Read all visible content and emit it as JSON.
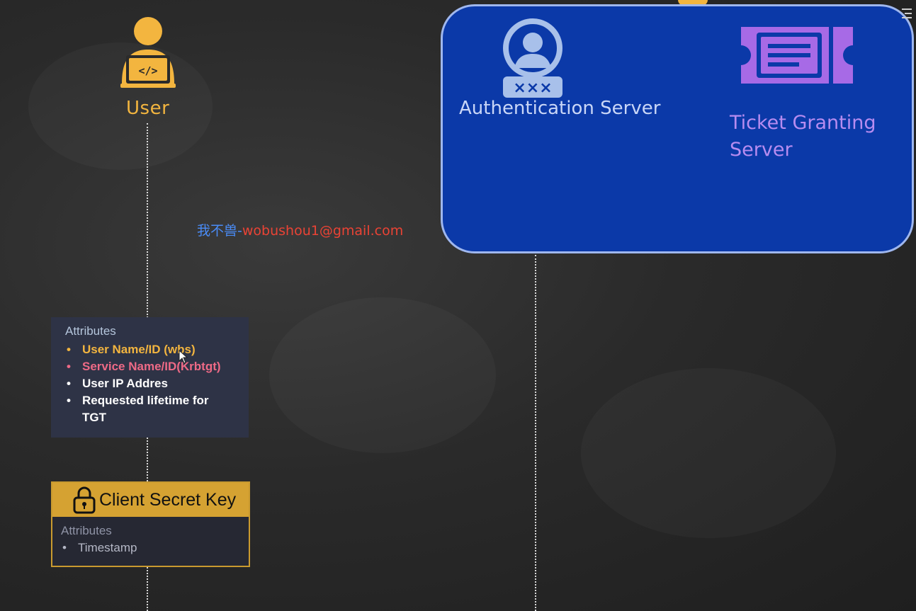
{
  "actors": {
    "user": {
      "label": "User",
      "icon": "developer-laptop-icon",
      "color": "#f3b53f"
    },
    "auth_server": {
      "label": "Authentication Server",
      "icon": "user-password-icon"
    },
    "tgs": {
      "label": "Ticket Granting Server",
      "icon": "ticket-icon"
    }
  },
  "watermark": {
    "cn": "我不兽",
    "sep": "-",
    "email": "wobushou1@gmail.com"
  },
  "attributes_box": {
    "title": "Attributes",
    "items": [
      {
        "text": "User Name/ID (wbs)",
        "color": "#f3b53f"
      },
      {
        "text": "Service Name/ID(Krbtgt)",
        "color": "#ee6a86"
      },
      {
        "text": "User IP Addres",
        "color": "#ffffff"
      },
      {
        "text": "Requested lifetime for TGT",
        "color": "#ffffff"
      }
    ]
  },
  "client_secret_key": {
    "title": "Client Secret Key",
    "icon": "padlock-icon",
    "attributes_title": "Attributes",
    "items": [
      "Timestamp"
    ]
  },
  "colors": {
    "server_box": "#0b39a8",
    "accent": "#f3b53f",
    "purple": "#b78cf0"
  }
}
